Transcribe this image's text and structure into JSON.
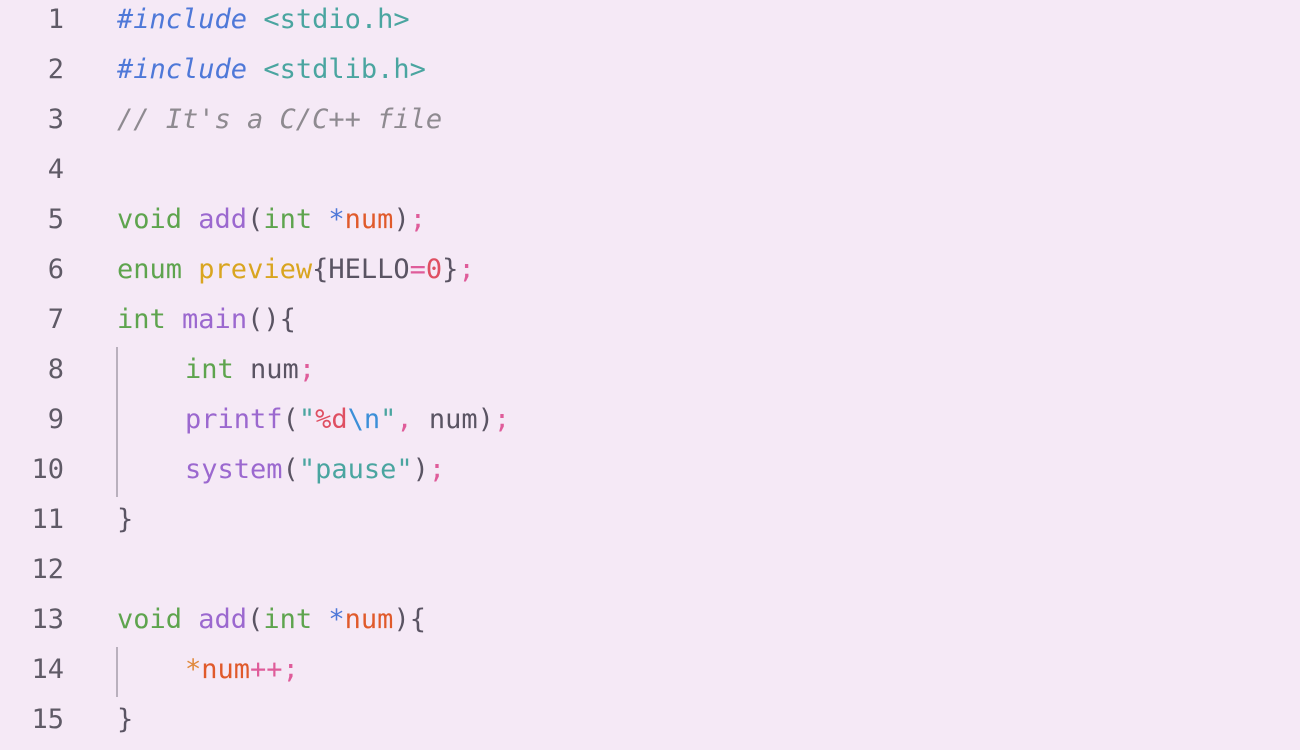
{
  "editor": {
    "language": "C",
    "lines": [
      {
        "number": "1",
        "tokens": [
          {
            "text": "#include",
            "kind": "preproc"
          },
          {
            "text": " ",
            "kind": "punc"
          },
          {
            "text": "<stdio.h>",
            "kind": "header"
          }
        ]
      },
      {
        "number": "2",
        "tokens": [
          {
            "text": "#include",
            "kind": "preproc"
          },
          {
            "text": " ",
            "kind": "punc"
          },
          {
            "text": "<stdlib.h>",
            "kind": "header"
          }
        ]
      },
      {
        "number": "3",
        "tokens": [
          {
            "text": "// It's a C/C++ file",
            "kind": "comment"
          }
        ]
      },
      {
        "number": "4",
        "tokens": []
      },
      {
        "number": "5",
        "tokens": [
          {
            "text": "void",
            "kind": "type"
          },
          {
            "text": " ",
            "kind": "punc"
          },
          {
            "text": "add",
            "kind": "func"
          },
          {
            "text": "(",
            "kind": "punc"
          },
          {
            "text": "int",
            "kind": "type"
          },
          {
            "text": " ",
            "kind": "punc"
          },
          {
            "text": "*",
            "kind": "star"
          },
          {
            "text": "num",
            "kind": "param"
          },
          {
            "text": ")",
            "kind": "punc"
          },
          {
            "text": ";",
            "kind": "semi"
          }
        ]
      },
      {
        "number": "6",
        "tokens": [
          {
            "text": "enum",
            "kind": "type"
          },
          {
            "text": " ",
            "kind": "punc"
          },
          {
            "text": "preview",
            "kind": "enumname"
          },
          {
            "text": "{",
            "kind": "punc"
          },
          {
            "text": "HELLO",
            "kind": "const"
          },
          {
            "text": "=",
            "kind": "op"
          },
          {
            "text": "0",
            "kind": "num"
          },
          {
            "text": "}",
            "kind": "punc"
          },
          {
            "text": ";",
            "kind": "semi"
          }
        ]
      },
      {
        "number": "7",
        "tokens": [
          {
            "text": "int",
            "kind": "type"
          },
          {
            "text": " ",
            "kind": "punc"
          },
          {
            "text": "main",
            "kind": "func"
          },
          {
            "text": "(){",
            "kind": "punc"
          }
        ]
      },
      {
        "number": "8",
        "indent": 1,
        "tokens": [
          {
            "text": "int",
            "kind": "type"
          },
          {
            "text": " num",
            "kind": "punc"
          },
          {
            "text": ";",
            "kind": "semi"
          }
        ]
      },
      {
        "number": "9",
        "indent": 1,
        "tokens": [
          {
            "text": "printf",
            "kind": "func"
          },
          {
            "text": "(",
            "kind": "punc"
          },
          {
            "text": "\"",
            "kind": "str"
          },
          {
            "text": "%d",
            "kind": "fmt"
          },
          {
            "text": "\\n",
            "kind": "esc"
          },
          {
            "text": "\"",
            "kind": "str"
          },
          {
            "text": ",",
            "kind": "semi"
          },
          {
            "text": " num)",
            "kind": "punc"
          },
          {
            "text": ";",
            "kind": "semi"
          }
        ]
      },
      {
        "number": "10",
        "indent": 1,
        "tokens": [
          {
            "text": "system",
            "kind": "func"
          },
          {
            "text": "(",
            "kind": "punc"
          },
          {
            "text": "\"pause\"",
            "kind": "str"
          },
          {
            "text": ")",
            "kind": "punc"
          },
          {
            "text": ";",
            "kind": "semi"
          }
        ]
      },
      {
        "number": "11",
        "tokens": [
          {
            "text": "}",
            "kind": "punc"
          }
        ]
      },
      {
        "number": "12",
        "tokens": []
      },
      {
        "number": "13",
        "tokens": [
          {
            "text": "void",
            "kind": "type"
          },
          {
            "text": " ",
            "kind": "punc"
          },
          {
            "text": "add",
            "kind": "func"
          },
          {
            "text": "(",
            "kind": "punc"
          },
          {
            "text": "int",
            "kind": "type"
          },
          {
            "text": " ",
            "kind": "punc"
          },
          {
            "text": "*",
            "kind": "star"
          },
          {
            "text": "num",
            "kind": "param"
          },
          {
            "text": "){",
            "kind": "punc"
          }
        ]
      },
      {
        "number": "14",
        "indent": 1,
        "tokens": [
          {
            "text": "*",
            "kind": "deref"
          },
          {
            "text": "num",
            "kind": "param"
          },
          {
            "text": "++",
            "kind": "op"
          },
          {
            "text": ";",
            "kind": "semi"
          }
        ]
      },
      {
        "number": "15",
        "tokens": [
          {
            "text": "}",
            "kind": "punc"
          }
        ]
      }
    ],
    "colors": {
      "background": "#f5e9f6",
      "line_number": "#5f5a66",
      "indent_guide": "#b9b0bd"
    }
  }
}
